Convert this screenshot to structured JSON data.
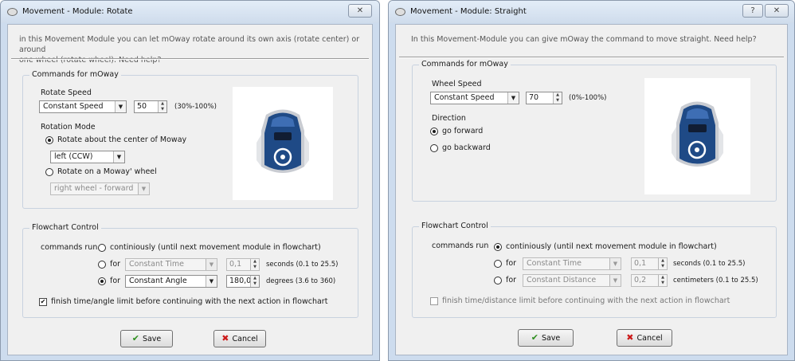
{
  "rotate_dialog": {
    "title": "Movement - Module: Rotate",
    "close_glyph": "✕",
    "intro_line1": "in this Movement Module you can let mOway rotate around its own axis (rotate center) or around",
    "intro_line2": "one wheel (rotate wheel). Need help?",
    "commands_group": "Commands for mOway",
    "rotate_speed_label": "Rotate Speed",
    "speed_mode": "Constant Speed",
    "speed_value": "50",
    "speed_range": "(30%-100%)",
    "rotation_mode_label": "Rotation Mode",
    "rotate_center_label": "Rotate about the center of Moway",
    "direction_value": "left (CCW)",
    "rotate_wheel_label": "Rotate on a Moway' wheel",
    "wheel_value": "right wheel - forward",
    "flowchart_group": "Flowchart Control",
    "commands_run_label": "commands run",
    "continuously_label": "continiously (until next movement module in flowchart)",
    "for_label": "for",
    "time_mode": "Constant Time",
    "time_value": "0,1",
    "time_unit": "seconds (0.1 to 25.5)",
    "angle_mode": "Constant Angle",
    "angle_value": "180,0",
    "angle_unit": "degrees (3.6 to 360)",
    "finish_label": "finish time/angle limit before continuing with the next action in flowchart",
    "save_label": "Save",
    "cancel_label": "Cancel"
  },
  "straight_dialog": {
    "title": "Movement - Module: Straight",
    "help_glyph": "?",
    "close_glyph": "✕",
    "intro": "In this Movement-Module you can give mOway the command to move straight. Need help?",
    "commands_group": "Commands for mOway",
    "wheel_speed_label": "Wheel Speed",
    "speed_mode": "Constant Speed",
    "speed_value": "70",
    "speed_range": "(0%-100%)",
    "direction_label": "Direction",
    "forward_label": "go forward",
    "backward_label": "go backward",
    "flowchart_group": "Flowchart Control",
    "commands_run_label": "commands run",
    "continuously_label": "continiously (until next movement module in flowchart)",
    "for_label": "for",
    "time_mode": "Constant Time",
    "time_value": "0,1",
    "time_unit": "seconds (0.1 to 25.5)",
    "distance_mode": "Constant Distance",
    "distance_value": "0,2",
    "distance_unit": "centimeters (0.1 to 25.5)",
    "finish_label": "finish time/distance limit before continuing with the next action in flowchart",
    "save_label": "Save",
    "cancel_label": "Cancel"
  },
  "icons": {
    "check": "✔",
    "cross": "✖",
    "combo_arrow": "▼",
    "spin_up": "▲",
    "spin_down": "▼",
    "checkmark": "✔"
  },
  "colors": {
    "window_frame": "#cddcee",
    "dialog_face": "#f0f0f0",
    "robot_body": "#1f4a86",
    "save_icon": "#2f8f1f",
    "cancel_icon": "#cc1a1a"
  }
}
